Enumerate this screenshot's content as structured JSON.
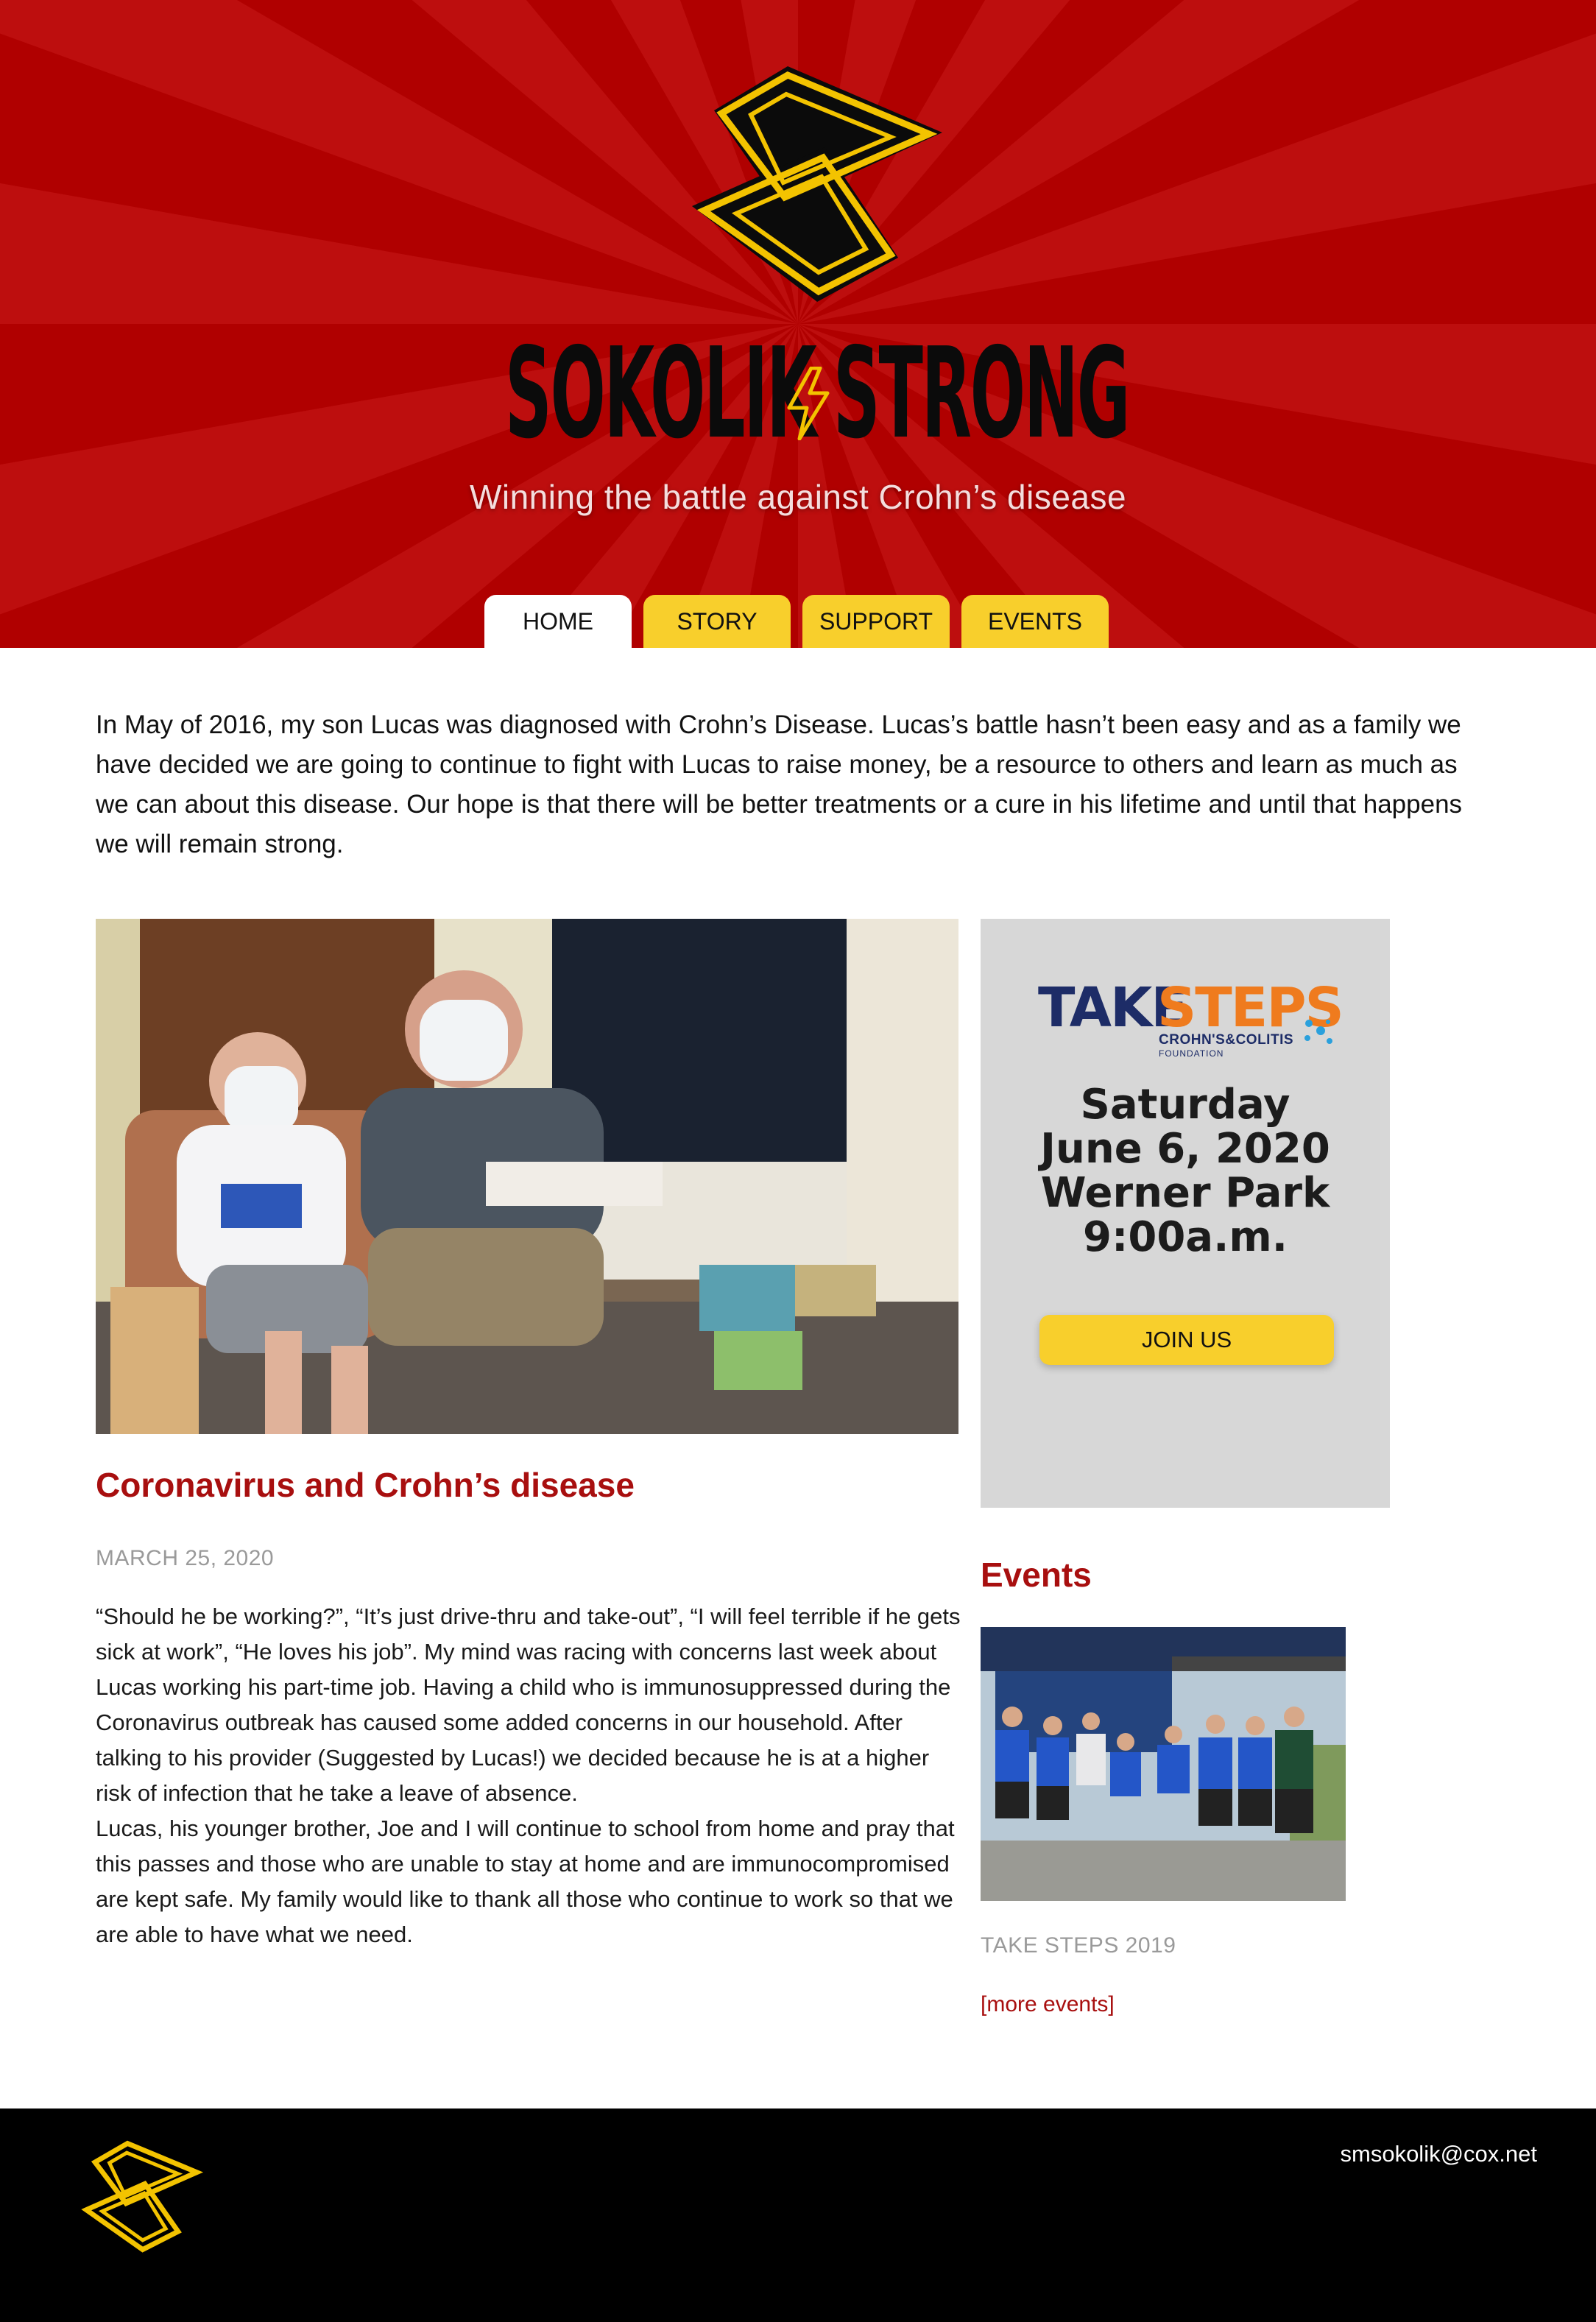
{
  "header": {
    "brand_left": "SOKOLIK",
    "brand_right": "STRONG",
    "tagline": "Winning the battle against Crohn’s disease",
    "nav": [
      {
        "label": "HOME",
        "active": true
      },
      {
        "label": "STORY",
        "active": false
      },
      {
        "label": "SUPPORT",
        "active": false
      },
      {
        "label": "EVENTS",
        "active": false
      }
    ]
  },
  "intro": "In May of 2016, my son Lucas was diagnosed with Crohn’s Disease. Lucas’s battle hasn’t been easy and as a family we have decided we are going to continue to fight with Lucas to raise money, be a resource to others and learn as much as we can about this disease. Our hope is that there will be better treatments or a cure in his lifetime and until that happens we will remain strong.",
  "post": {
    "title": "Coronavirus and Crohn’s disease",
    "date": "MARCH 25, 2020",
    "paragraph1": "“Should he be working?”, “It’s just drive-thru and take-out”, “I will feel terrible if he gets sick at work”, “He loves his job”. My mind was racing with concerns last week about Lucas working his part-time job. Having a child who is immunosuppressed during the Coronavirus outbreak has caused some added concerns in our household. After talking to his provider (Suggested by Lucas!) we decided because he is at a higher risk of infection that he take a leave of absence.",
    "paragraph2": "Lucas, his younger brother, Joe and I will continue to school from home and pray that this passes and those who are unable to stay at home and are immunocompromised are kept safe. My family would like to thank all those who continue to work so that we are able to have what we need."
  },
  "promo": {
    "logo_take": "TAKE",
    "logo_steps": "STEPS",
    "logo_sub": "CROHN'S&COLITIS",
    "logo_foundation": "FOUNDATION",
    "day": "Saturday",
    "date": "June 6, 2020",
    "venue": "Werner Park",
    "time": "9:00a.m.",
    "button": "JOIN US"
  },
  "events": {
    "heading": "Events",
    "caption": "TAKE STEPS 2019",
    "more": "[more events]"
  },
  "footer": {
    "email": "smsokolik@cox.net"
  },
  "colors": {
    "hero_red": "#b00000",
    "accent_yellow": "#f8cf2c",
    "link_red": "#a80f0f",
    "promo_grey": "#d7d7d7"
  }
}
